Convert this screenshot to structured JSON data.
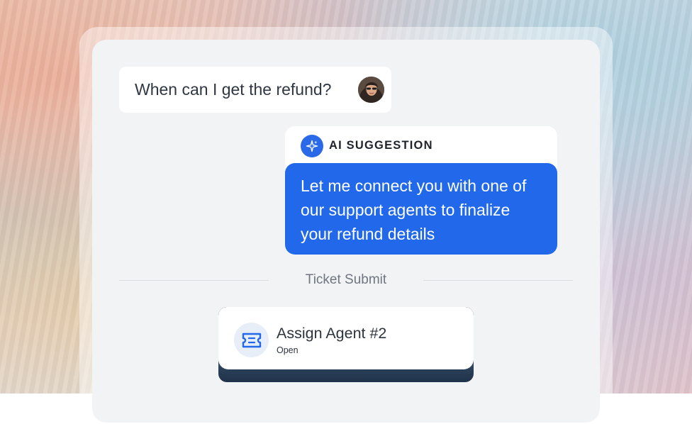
{
  "chat": {
    "user_message": "When can I get the refund?",
    "ai_label": "AI SUGGESTION",
    "ai_message": "Let me connect you with one of our support agents to finalize your refund details"
  },
  "divider": {
    "label": "Ticket Submit"
  },
  "ticket": {
    "title": "Assign Agent #2",
    "status": "Open",
    "icon": "ticket-icon"
  },
  "colors": {
    "accent": "#2168ea",
    "panel": "#f2f3f5"
  }
}
